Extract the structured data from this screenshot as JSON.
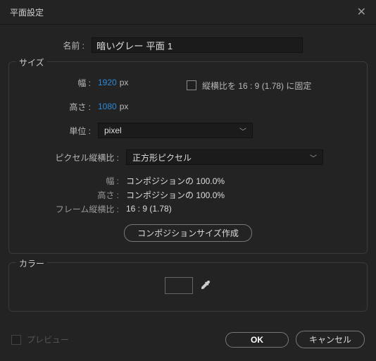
{
  "title": "平面設定",
  "name": {
    "label": "名前 :",
    "value": "暗いグレー 平面 1"
  },
  "size": {
    "legend": "サイズ",
    "width": {
      "label": "幅 :",
      "value": "1920",
      "unit": "px"
    },
    "height": {
      "label": "高さ :",
      "value": "1080",
      "unit": "px"
    },
    "lock_label": "縦横比を 16 : 9 (1.78) に固定",
    "unit": {
      "label": "単位 :",
      "value": "pixel"
    },
    "par": {
      "label": "ピクセル縦横比 :",
      "value": "正方形ピクセル"
    },
    "info_width": {
      "label": "幅 :",
      "value": "コンポジションの 100.0%"
    },
    "info_height": {
      "label": "高さ :",
      "value": "コンポジションの 100.0%"
    },
    "info_frame": {
      "label": "フレーム縦横比 :",
      "value": "16 : 9 (1.78)"
    },
    "make_comp_size": "コンポジションサイズ作成"
  },
  "color": {
    "legend": "カラー",
    "swatch_hex": "#242424"
  },
  "footer": {
    "preview": "プレビュー",
    "ok": "OK",
    "cancel": "キャンセル"
  }
}
